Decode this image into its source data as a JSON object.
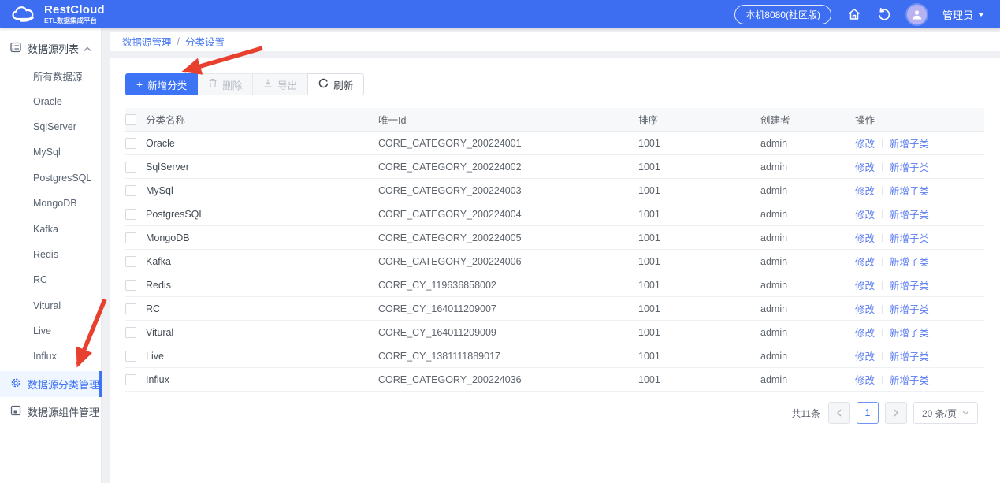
{
  "header": {
    "logo_title": "RestCloud",
    "logo_subtitle": "ETL数据集成平台",
    "env_badge": "本机8080(社区版)",
    "user_name": "管理员"
  },
  "sidebar": {
    "group_label": "数据源列表",
    "group_items": [
      "所有数据源",
      "Oracle",
      "SqlServer",
      "MySql",
      "PostgresSQL",
      "MongoDB",
      "Kafka",
      "Redis",
      "RC",
      "Vitural",
      "Live",
      "Influx"
    ],
    "category_item": "数据源分类管理",
    "component_item": "数据源组件管理"
  },
  "breadcrumb": {
    "parent": "数据源管理",
    "separator": "/",
    "current": "分类设置"
  },
  "toolbar": {
    "add_label": "新增分类",
    "delete_label": "删除",
    "export_label": "导出",
    "refresh_label": "刷新"
  },
  "table": {
    "headers": {
      "name": "分类名称",
      "id": "唯一Id",
      "order": "排序",
      "creator": "创建者",
      "ops": "操作"
    },
    "action_edit": "修改",
    "action_separator": "|",
    "action_add_child": "新增子类",
    "rows": [
      {
        "name": "Oracle",
        "id": "CORE_CATEGORY_200224001",
        "order": "1001",
        "creator": "admin"
      },
      {
        "name": "SqlServer",
        "id": "CORE_CATEGORY_200224002",
        "order": "1001",
        "creator": "admin"
      },
      {
        "name": "MySql",
        "id": "CORE_CATEGORY_200224003",
        "order": "1001",
        "creator": "admin"
      },
      {
        "name": "PostgresSQL",
        "id": "CORE_CATEGORY_200224004",
        "order": "1001",
        "creator": "admin"
      },
      {
        "name": "MongoDB",
        "id": "CORE_CATEGORY_200224005",
        "order": "1001",
        "creator": "admin"
      },
      {
        "name": "Kafka",
        "id": "CORE_CATEGORY_200224006",
        "order": "1001",
        "creator": "admin"
      },
      {
        "name": "Redis",
        "id": "CORE_CY_119636858002",
        "order": "1001",
        "creator": "admin"
      },
      {
        "name": "RC",
        "id": "CORE_CY_164011209007",
        "order": "1001",
        "creator": "admin"
      },
      {
        "name": "Vitural",
        "id": "CORE_CY_164011209009",
        "order": "1001",
        "creator": "admin"
      },
      {
        "name": "Live",
        "id": "CORE_CY_1381111889017",
        "order": "1001",
        "creator": "admin"
      },
      {
        "name": "Influx",
        "id": "CORE_CATEGORY_200224036",
        "order": "1001",
        "creator": "admin"
      }
    ]
  },
  "pagination": {
    "total": "共11条",
    "page": "1",
    "page_size": "20 条/页"
  },
  "colors": {
    "header_blue": "#3d6ef2",
    "primary_blue": "#3d73f5",
    "link_blue": "#5b7cf0",
    "arrow_red": "#e8402e"
  }
}
